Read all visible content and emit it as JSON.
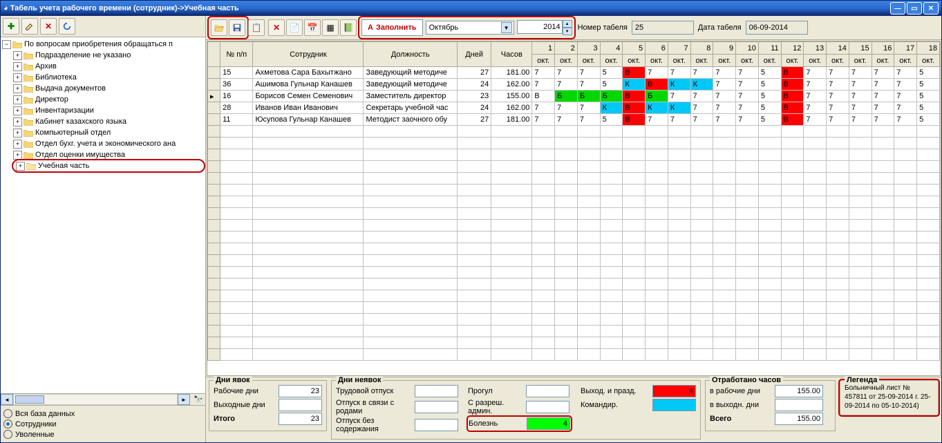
{
  "window": {
    "title": "Табель учета рабочего времени (сотрудник)->Учебная часть"
  },
  "toolbar": {
    "fill_label": "Заполнить",
    "month": "Октябрь",
    "year": "2014",
    "num_label": "Номер табеля",
    "num_value": "25",
    "date_label": "Дата табеля",
    "date_value": "06-09-2014"
  },
  "tree": {
    "root": "По вопросам приобретения обращаться п",
    "items": [
      "Подразделение не указано",
      "Архив",
      "Библиотека",
      "Выдача документов",
      "Директор",
      "Инвентаризации",
      "Кабинет казахского языка",
      "Компьютерный отдел",
      "Отдел бухг. учета и экономического ана",
      "Отдел оценки имущества",
      "Учебная часть"
    ]
  },
  "radios": {
    "r1": "Вся база данных",
    "r2": "Сотрудники",
    "r3": "Уволенные"
  },
  "grid": {
    "headers": {
      "num": "№ п/п",
      "emp": "Сотрудник",
      "pos": "Должность",
      "days": "Дней",
      "hours": "Часов",
      "okt": "окт."
    },
    "day_cols": [
      1,
      2,
      3,
      4,
      5,
      6,
      7,
      8,
      9,
      10,
      11,
      12,
      13,
      14,
      15,
      16,
      17,
      18
    ],
    "rows": [
      {
        "n": "15",
        "emp": "Ахметова Сара Бахытжано",
        "pos": "Заведующий методиче",
        "d": "27",
        "h": "181.00",
        "cells": [
          {
            "v": "7"
          },
          {
            "v": "7"
          },
          {
            "v": "7"
          },
          {
            "v": "5"
          },
          {
            "v": "В",
            "c": "red"
          },
          {
            "v": "7"
          },
          {
            "v": "7"
          },
          {
            "v": "7"
          },
          {
            "v": "7"
          },
          {
            "v": "7"
          },
          {
            "v": "5"
          },
          {
            "v": "В",
            "c": "red"
          },
          {
            "v": "7"
          },
          {
            "v": "7"
          },
          {
            "v": "7"
          },
          {
            "v": "7"
          },
          {
            "v": "7"
          },
          {
            "v": "5"
          }
        ]
      },
      {
        "n": "36",
        "emp": "Ашимова Гульнар Канашев",
        "pos": "Заведующий методиче",
        "d": "24",
        "h": "162.00",
        "cells": [
          {
            "v": "7"
          },
          {
            "v": "7"
          },
          {
            "v": "7"
          },
          {
            "v": "5"
          },
          {
            "v": "К",
            "c": "cyan"
          },
          {
            "v": "В",
            "c": "red"
          },
          {
            "v": "К",
            "c": "cyan"
          },
          {
            "v": "К",
            "c": "cyan"
          },
          {
            "v": "7"
          },
          {
            "v": "7"
          },
          {
            "v": "5"
          },
          {
            "v": "В",
            "c": "red"
          },
          {
            "v": "7"
          },
          {
            "v": "7"
          },
          {
            "v": "7"
          },
          {
            "v": "7"
          },
          {
            "v": "7"
          },
          {
            "v": "5"
          }
        ]
      },
      {
        "n": "16",
        "emp": "Борисов Семен Семенович",
        "pos": "Заместитель директор",
        "d": "23",
        "h": "155.00",
        "sel": true,
        "cells": [
          {
            "v": "В"
          },
          {
            "v": "Б",
            "c": "green"
          },
          {
            "v": "Б",
            "c": "green"
          },
          {
            "v": "Б",
            "c": "green"
          },
          {
            "v": "В",
            "c": "red"
          },
          {
            "v": "Б",
            "c": "green"
          },
          {
            "v": "7"
          },
          {
            "v": "7"
          },
          {
            "v": "7"
          },
          {
            "v": "7"
          },
          {
            "v": "5"
          },
          {
            "v": "В",
            "c": "red"
          },
          {
            "v": "7"
          },
          {
            "v": "7"
          },
          {
            "v": "7"
          },
          {
            "v": "7"
          },
          {
            "v": "7"
          },
          {
            "v": "5"
          }
        ]
      },
      {
        "n": "28",
        "emp": "Иванов Иван Иванович",
        "pos": "Секретарь учебной час",
        "d": "24",
        "h": "162.00",
        "cells": [
          {
            "v": "7"
          },
          {
            "v": "7"
          },
          {
            "v": "7"
          },
          {
            "v": "К",
            "c": "cyan"
          },
          {
            "v": "В",
            "c": "red"
          },
          {
            "v": "К",
            "c": "cyan"
          },
          {
            "v": "К",
            "c": "cyan"
          },
          {
            "v": "7"
          },
          {
            "v": "7"
          },
          {
            "v": "7"
          },
          {
            "v": "5"
          },
          {
            "v": "В",
            "c": "red"
          },
          {
            "v": "7"
          },
          {
            "v": "7"
          },
          {
            "v": "7"
          },
          {
            "v": "7"
          },
          {
            "v": "7"
          },
          {
            "v": "5"
          }
        ]
      },
      {
        "n": "11",
        "emp": "Юсупова Гульнар Канашев",
        "pos": "Методист заочного обу",
        "d": "27",
        "h": "181.00",
        "cells": [
          {
            "v": "7"
          },
          {
            "v": "7"
          },
          {
            "v": "7"
          },
          {
            "v": "5"
          },
          {
            "v": "В",
            "c": "red"
          },
          {
            "v": "7"
          },
          {
            "v": "7"
          },
          {
            "v": "7"
          },
          {
            "v": "7"
          },
          {
            "v": "7"
          },
          {
            "v": "5"
          },
          {
            "v": "В",
            "c": "red"
          },
          {
            "v": "7"
          },
          {
            "v": "7"
          },
          {
            "v": "7"
          },
          {
            "v": "7"
          },
          {
            "v": "7"
          },
          {
            "v": "5"
          }
        ]
      }
    ]
  },
  "footer": {
    "present": {
      "title": "Дни явок",
      "work_l": "Рабочие дни",
      "work_v": "23",
      "off_l": "Выходные дни",
      "off_v": "",
      "total_l": "Итого",
      "total_v": "23"
    },
    "absent": {
      "title": "Дни неявок",
      "vac_l": "Трудовой отпуск",
      "vac_v": "",
      "mat_l": "Отпуск в связи с родами",
      "mat_v": "",
      "unp_l": "Отпуск без содержания",
      "unp_v": "",
      "abs_l": "Прогул",
      "abs_v": "",
      "adm_l": "С разреш. админ.",
      "adm_v": "",
      "sick_l": "Болезнь",
      "sick_v": "4",
      "hol_l": "Выход. и празд.",
      "hol_v": "4",
      "trip_l": "Командир.",
      "trip_v": ""
    },
    "hours": {
      "title": "Отработано часов",
      "work_l": "в рабочие дни",
      "work_v": "155.00",
      "off_l": "в выходн. дни",
      "off_v": "",
      "total_l": "Всего",
      "total_v": "155.00"
    },
    "legend": {
      "title": "Легенда",
      "text": "Больничный лист № 457811 от 25-09-2014 г. 25-09-2014 по 05-10-2014)"
    }
  }
}
